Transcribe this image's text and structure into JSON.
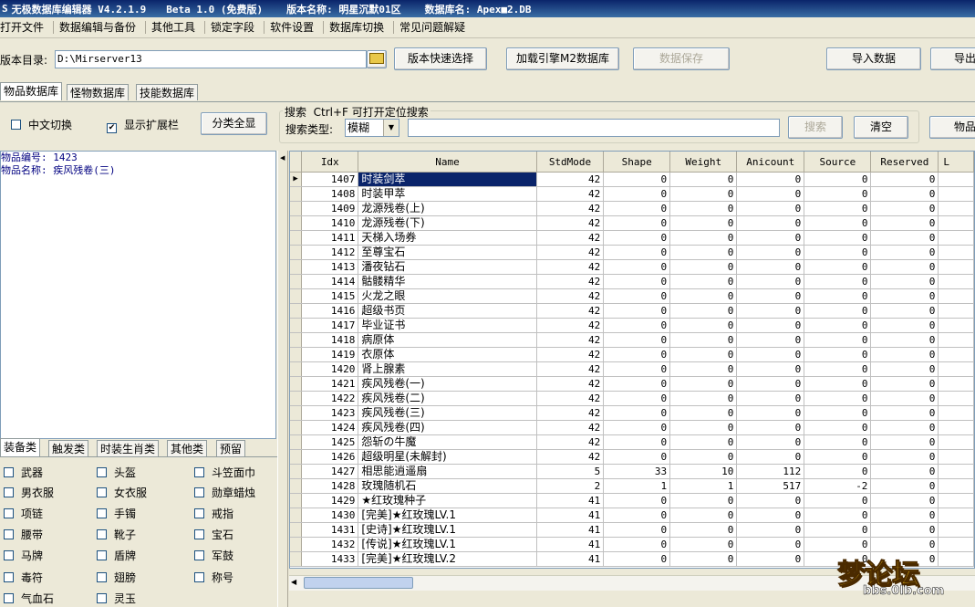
{
  "title": {
    "app": "无极数据库编辑器 V4.2.1.9",
    "edition": "Beta 1.0 (免费版)",
    "version_label": "版本名称: 明星沉默01区",
    "db_label": "数据库名: Apex■2.DB"
  },
  "menu": [
    "打开文件",
    "数据编辑与备份",
    "其他工具",
    "锁定字段",
    "软件设置",
    "数据库切换",
    "常见问题解疑"
  ],
  "toolbar": {
    "dir_label": "版本目录:",
    "dir_value": "D:\\Mirserver13",
    "quick_select": "版本快速选择",
    "load_engine": "加载引擎M2数据库",
    "save_data": "数据保存",
    "import_data": "导入数据",
    "export_data": "导出"
  },
  "db_tabs": [
    "物品数据库",
    "怪物数据库",
    "技能数据库"
  ],
  "options": {
    "chinese_switch": "中文切换",
    "chinese_checked": false,
    "show_ext": "显示扩展栏",
    "show_ext_checked": true,
    "show_all": "分类全显"
  },
  "search": {
    "legend": "搜索  Ctrl+F 可打开定位搜索",
    "type_label": "搜索类型:",
    "type_value": "模糊",
    "query": "",
    "search_btn": "搜索",
    "clear_btn": "清空",
    "item_btn": "物品"
  },
  "info": {
    "line1": "物品编号: 1423",
    "line2": "物品名称: 疾风残卷(三)"
  },
  "category_tabs": [
    "装备类",
    "触发类",
    "时装生肖类",
    "其他类",
    "预留"
  ],
  "categories": [
    "武器",
    "头盔",
    "斗笠面巾",
    "男衣服",
    "女衣服",
    "勋章蜡烛",
    "项链",
    "手镯",
    "戒指",
    "腰带",
    "靴子",
    "宝石",
    "马牌",
    "盾牌",
    "军鼓",
    "毒符",
    "翅膀",
    "称号",
    "气血石",
    "灵玉"
  ],
  "table": {
    "columns": [
      "Idx",
      "Name",
      "StdMode",
      "Shape",
      "Weight",
      "Anicount",
      "Source",
      "Reserved",
      "L"
    ],
    "rows": [
      [
        "1407",
        "时装剑萃",
        "42",
        "0",
        "0",
        "0",
        "0",
        "0"
      ],
      [
        "1408",
        "时装甲萃",
        "42",
        "0",
        "0",
        "0",
        "0",
        "0"
      ],
      [
        "1409",
        "龙源残卷(上)",
        "42",
        "0",
        "0",
        "0",
        "0",
        "0"
      ],
      [
        "1410",
        "龙源残卷(下)",
        "42",
        "0",
        "0",
        "0",
        "0",
        "0"
      ],
      [
        "1411",
        "天梯入场券",
        "42",
        "0",
        "0",
        "0",
        "0",
        "0"
      ],
      [
        "1412",
        "至尊宝石",
        "42",
        "0",
        "0",
        "0",
        "0",
        "0"
      ],
      [
        "1413",
        "潘夜钻石",
        "42",
        "0",
        "0",
        "0",
        "0",
        "0"
      ],
      [
        "1414",
        "骷髅精华",
        "42",
        "0",
        "0",
        "0",
        "0",
        "0"
      ],
      [
        "1415",
        "火龙之眼",
        "42",
        "0",
        "0",
        "0",
        "0",
        "0"
      ],
      [
        "1416",
        "超级书页",
        "42",
        "0",
        "0",
        "0",
        "0",
        "0"
      ],
      [
        "1417",
        "毕业证书",
        "42",
        "0",
        "0",
        "0",
        "0",
        "0"
      ],
      [
        "1418",
        "病原体",
        "42",
        "0",
        "0",
        "0",
        "0",
        "0"
      ],
      [
        "1419",
        "衣原体",
        "42",
        "0",
        "0",
        "0",
        "0",
        "0"
      ],
      [
        "1420",
        "肾上腺素",
        "42",
        "0",
        "0",
        "0",
        "0",
        "0"
      ],
      [
        "1421",
        "疾风残卷(一)",
        "42",
        "0",
        "0",
        "0",
        "0",
        "0"
      ],
      [
        "1422",
        "疾风残卷(二)",
        "42",
        "0",
        "0",
        "0",
        "0",
        "0"
      ],
      [
        "1423",
        "疾风残卷(三)",
        "42",
        "0",
        "0",
        "0",
        "0",
        "0"
      ],
      [
        "1424",
        "疾风残卷(四)",
        "42",
        "0",
        "0",
        "0",
        "0",
        "0"
      ],
      [
        "1425",
        "怨斩の牛魔",
        "42",
        "0",
        "0",
        "0",
        "0",
        "0"
      ],
      [
        "1426",
        "超级明星(未解封)",
        "42",
        "0",
        "0",
        "0",
        "0",
        "0"
      ],
      [
        "1427",
        "相思能逍遥扇",
        "5",
        "33",
        "10",
        "112",
        "0",
        "0"
      ],
      [
        "1428",
        "玫瑰随机石",
        "2",
        "1",
        "1",
        "517",
        "-2",
        "0"
      ],
      [
        "1429",
        "★红玫瑰种子",
        "41",
        "0",
        "0",
        "0",
        "0",
        "0"
      ],
      [
        "1430",
        "[完美]★红玫瑰LV.1",
        "41",
        "0",
        "0",
        "0",
        "0",
        "0"
      ],
      [
        "1431",
        "[史诗]★红玫瑰LV.1",
        "41",
        "0",
        "0",
        "0",
        "0",
        "0"
      ],
      [
        "1432",
        "[传说]★红玫瑰LV.1",
        "41",
        "0",
        "0",
        "0",
        "0",
        "0"
      ],
      [
        "1433",
        "[完美]★红玫瑰LV.2",
        "41",
        "0",
        "0",
        "0",
        "0",
        "0"
      ]
    ],
    "selected_row": 0
  },
  "watermark": {
    "text": "梦论坛",
    "url": "bbs.0lb.com"
  },
  "colors": {
    "title_start": "#0a246a",
    "title_end": "#3a6ea5",
    "selection": "#0a246a",
    "face": "#ece9d8"
  }
}
